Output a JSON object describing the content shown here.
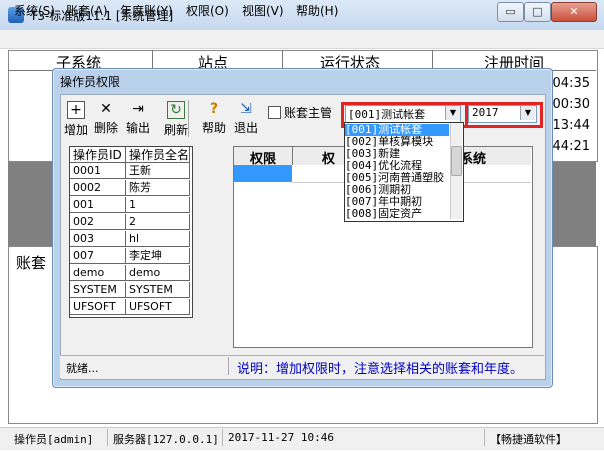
{
  "window": {
    "title": "T3-标准版11.1 [系统管理]",
    "min_symbol": "▭",
    "max_symbol": "□",
    "close_symbol": "✕"
  },
  "menu": [
    "系统(S)",
    "账套(A)",
    "年度账(Y)",
    "权限(O)",
    "视图(V)",
    "帮助(H)"
  ],
  "background": {
    "headers": [
      "子系统",
      "站点",
      "运行状态",
      "注册时间"
    ],
    "times": [
      "04:35",
      "00:30",
      "13:44",
      "44:21"
    ],
    "lower_label": "账套"
  },
  "statusbar": {
    "operator": "操作员[admin]",
    "server": "服务器[127.0.0.1]",
    "datetime": "2017-11-27 10:46",
    "brand": "【畅捷通软件】"
  },
  "dialog": {
    "title": "操作员权限",
    "toolbar": [
      {
        "label": "增加",
        "icon": "add-icon",
        "glyph": "+"
      },
      {
        "label": "删除",
        "icon": "delete-icon",
        "glyph": "✕"
      },
      {
        "label": "输出",
        "icon": "export-icon",
        "glyph": "⇥"
      },
      {
        "label": "刷新",
        "icon": "refresh-icon",
        "glyph": "↻"
      },
      {
        "label": "帮助",
        "icon": "help-icon",
        "glyph": "?"
      },
      {
        "label": "退出",
        "icon": "exit-icon",
        "glyph": "⇲"
      }
    ],
    "account_master_label": "账套主管",
    "account_select": {
      "value": "[001]测试帐套",
      "arrow": "▼"
    },
    "year_select": {
      "value": "2017",
      "arrow": "▼"
    },
    "account_options": [
      "[001]测试帐套",
      "[002]单核算模块",
      "[003]新建",
      "[004]优化流程",
      "[005]河南普通塑胶",
      "[006]测期初",
      "[007]年中期初",
      "[008]固定资产"
    ],
    "operators": {
      "headers": [
        "操作员ID",
        "操作员全名"
      ],
      "rows": [
        [
          "0001",
          "王新"
        ],
        [
          "0002",
          "陈芳"
        ],
        [
          "001",
          "1"
        ],
        [
          "002",
          "2"
        ],
        [
          "003",
          "hl"
        ],
        [
          "007",
          "李定坤"
        ],
        [
          "demo",
          "demo"
        ],
        [
          "SYSTEM",
          "SYSTEM"
        ],
        [
          "UFSOFT",
          "UFSOFT"
        ]
      ]
    },
    "permissions": {
      "headers": [
        "权限",
        "权",
        "系统"
      ]
    },
    "status_left": "就绪...",
    "note": "说明：增加权限时，注意选择相关的账套和年度。"
  }
}
